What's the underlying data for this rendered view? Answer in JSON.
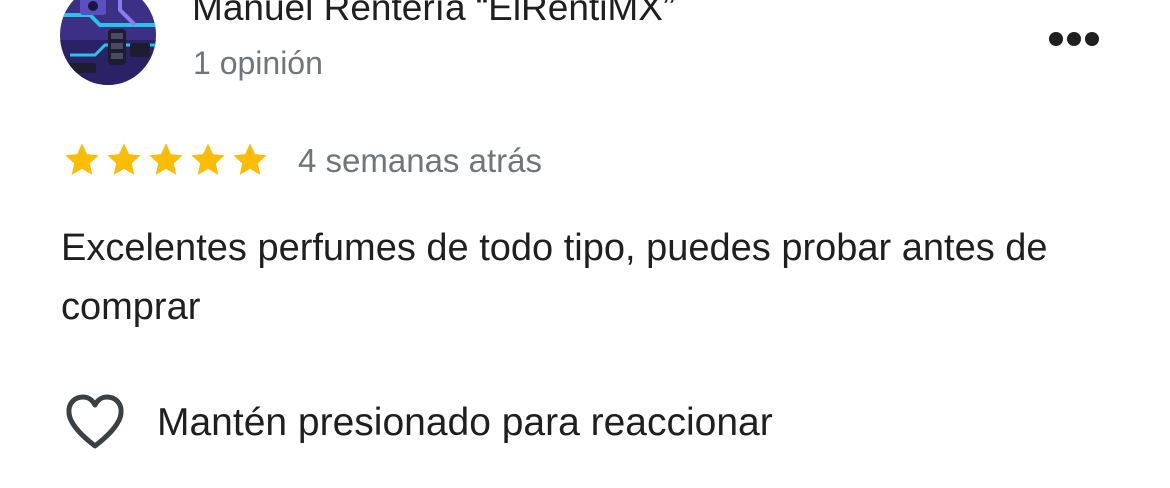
{
  "review": {
    "author": {
      "name": "Manuel Rentería “ElRentiMX”",
      "meta": "1 opinión",
      "avatar_icon": "circuit-avatar"
    },
    "menu_icon": "more-horizontal-icon",
    "rating": {
      "stars": 5,
      "max": 5,
      "star_color": "#fbbc04"
    },
    "date": "4 semanas atrás",
    "text": "Excelentes perfumes de todo tipo, puedes probar antes de comprar",
    "reaction": {
      "icon": "heart-outline-icon",
      "label": "Mantén presionado para reaccionar"
    }
  }
}
